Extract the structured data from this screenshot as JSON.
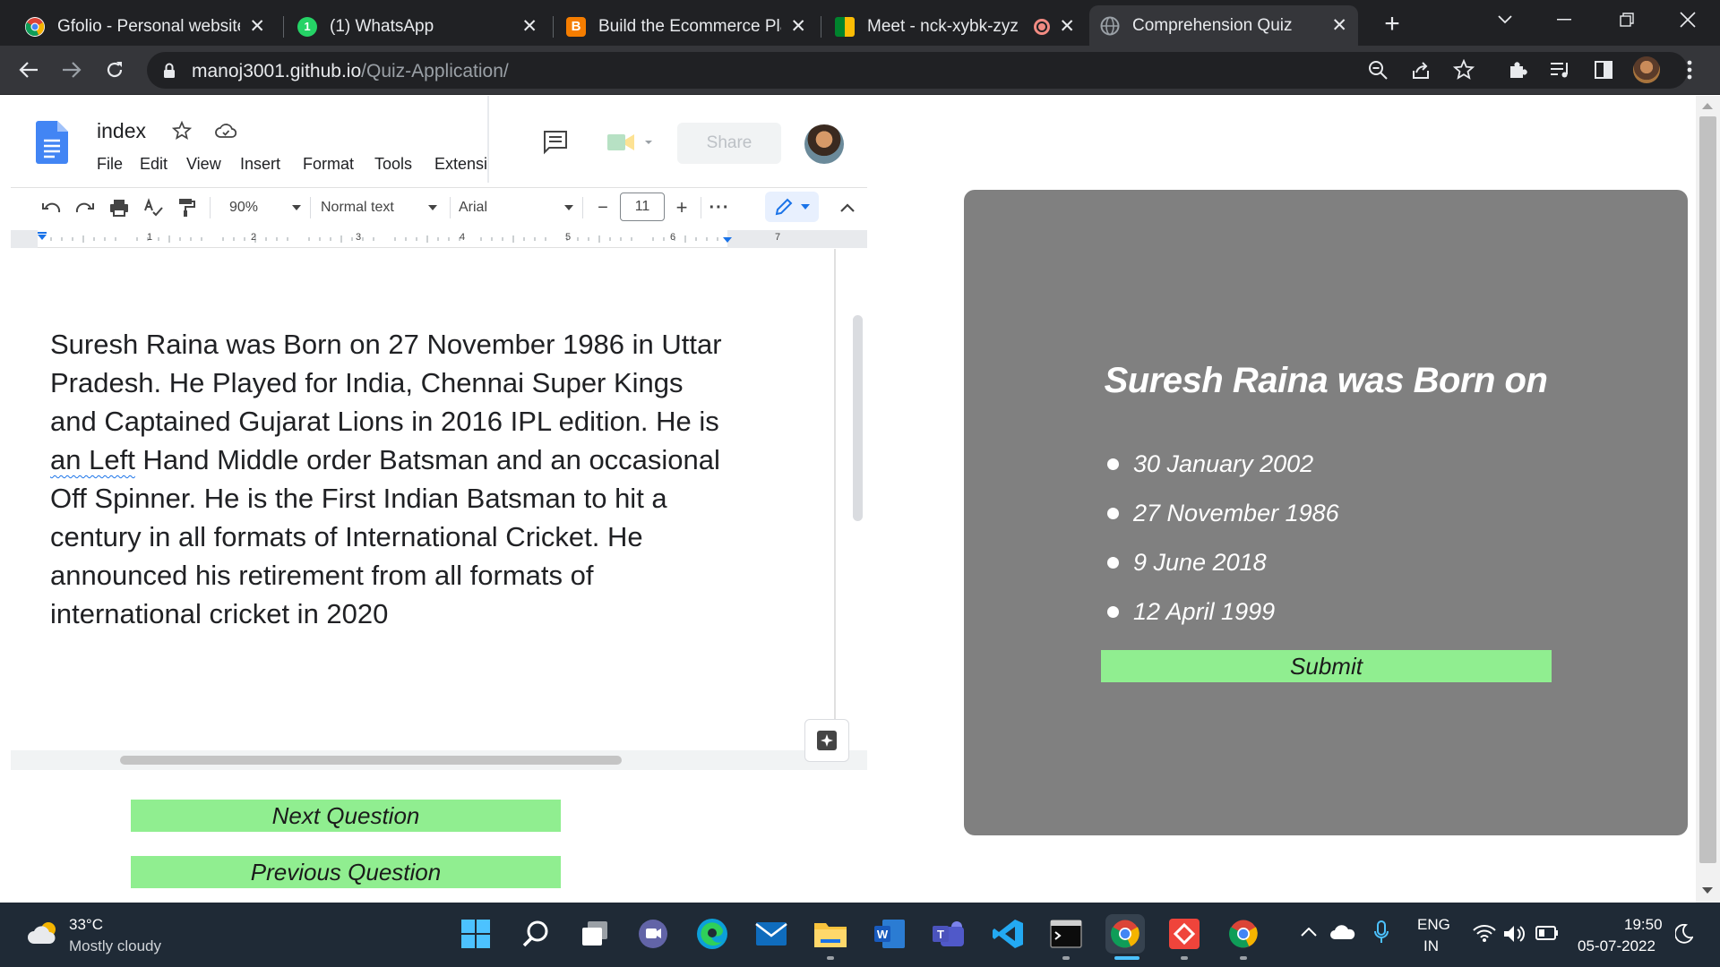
{
  "browser": {
    "tabs": [
      {
        "title": "Gfolio - Personal website",
        "favicon": "chrome-icon",
        "color": "#ffffff"
      },
      {
        "title": "(1) WhatsApp",
        "favicon": "whatsapp-icon",
        "color": "#25d366"
      },
      {
        "title": "Build the Ecommerce Plat",
        "favicon": "blogger-icon",
        "color": "#f57d00"
      },
      {
        "title": "Meet - nck-xybk-zyz",
        "favicon": "meet-icon",
        "color": "#00832d"
      },
      {
        "title": "Comprehension Quiz",
        "favicon": "globe-icon",
        "color": "#9aa0a6",
        "active": true
      }
    ],
    "url_host": "manoj3001.github.io",
    "url_path": "/Quiz-Application/"
  },
  "docs": {
    "title": "index",
    "menu": [
      "File",
      "Edit",
      "View",
      "Insert",
      "Format",
      "Tools",
      "Extensi"
    ],
    "share_label": "Share",
    "zoom": "90%",
    "style": "Normal text",
    "font": "Arial",
    "font_size": "11",
    "ruler_numbers": [
      "1",
      "2",
      "3",
      "4",
      "5",
      "6",
      "7"
    ],
    "body_before": "Suresh Raina was Born on 27 November 1986 in Uttar Pradesh. He Played for India, Chennai Super Kings and Captained Gujarat Lions in 2016 IPL edition. He is ",
    "body_marked": "an Left",
    "body_after": " Hand Middle order Batsman and an occasional Off Spinner. He is the First Indian Batsman to hit a century in all formats of International Cricket. He announced his retirement from all formats of international cricket in 2020"
  },
  "quiz": {
    "question": "Suresh Raina was Born on",
    "options": [
      "30 January 2002",
      "27 November 1986",
      "9 June 2018",
      "12 April 1999"
    ],
    "submit_label": "Submit",
    "next_label": "Next Question",
    "prev_label": "Previous Question",
    "button_color": "#90ee90",
    "panel_color": "#808080"
  },
  "taskbar": {
    "weather_temp": "33°C",
    "weather_desc": "Mostly cloudy",
    "lang_line1": "ENG",
    "lang_line2": "IN",
    "time": "19:50",
    "date": "05-07-2022"
  }
}
